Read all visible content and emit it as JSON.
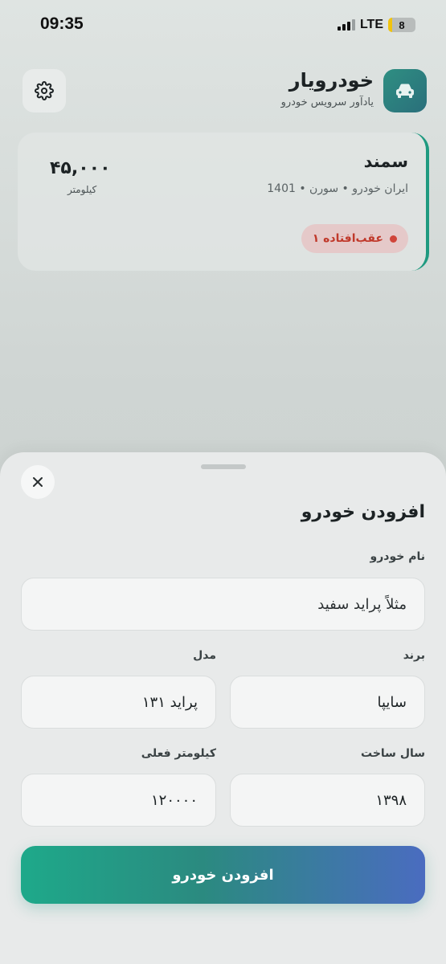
{
  "status_bar": {
    "time": "09:35",
    "network": "LTE",
    "battery": "8"
  },
  "header": {
    "title": "خودرویار",
    "subtitle": "یادآور سرویس خودرو",
    "settings_icon": "gear-icon",
    "logo_icon": "car-icon"
  },
  "car_card": {
    "name": "سمند",
    "meta": "ایران خودرو • سورن • 1401",
    "km": "۴۵,۰۰۰",
    "km_unit": "کیلومتر",
    "overdue": "۱ عقب‌افتاده",
    "accent": "#1f9a80",
    "overdue_color": "#d0453a"
  },
  "sheet": {
    "title": "افزودن خودرو",
    "close_icon": "close-icon",
    "fields": {
      "name_label": "نام خودرو",
      "name_placeholder": "مثلاً پراید سفید",
      "brand_label": "برند",
      "brand_value": "سایپا",
      "model_label": "مدل",
      "model_value": "پراید ۱۳۱",
      "year_label": "سال ساخت",
      "year_value": "۱۳۹۸",
      "km_label": "کیلومتر فعلی",
      "km_value": "۱۲۰۰۰۰"
    },
    "submit_label": "افزودن خودرو"
  }
}
